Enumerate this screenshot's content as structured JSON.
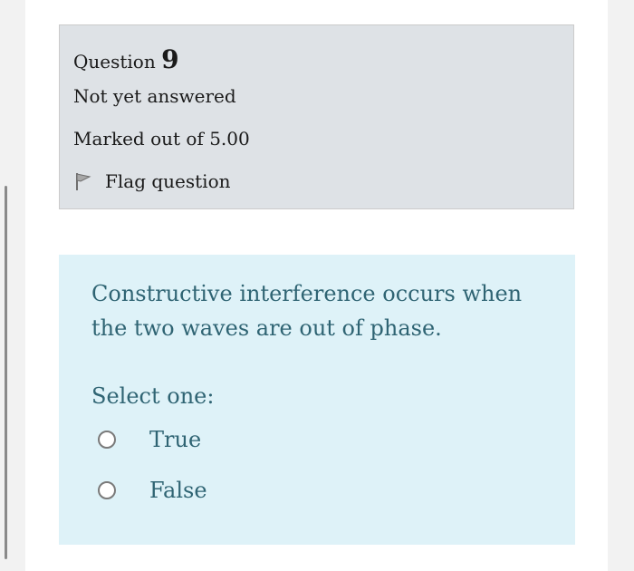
{
  "question_info": {
    "label": "Question",
    "number": "9",
    "state": "Not yet answered",
    "grade": "Marked out of 5.00",
    "flag_label": "Flag question",
    "flag_icon": "flag-icon"
  },
  "question": {
    "text": "Constructive interference occurs when the two waves are out of phase.",
    "prompt": "Select one:",
    "options": [
      {
        "label": "True",
        "selected": false
      },
      {
        "label": "False",
        "selected": false
      }
    ]
  },
  "colors": {
    "info_background": "#dee2e6",
    "content_background": "#def2f8",
    "content_text": "#2f6473"
  }
}
